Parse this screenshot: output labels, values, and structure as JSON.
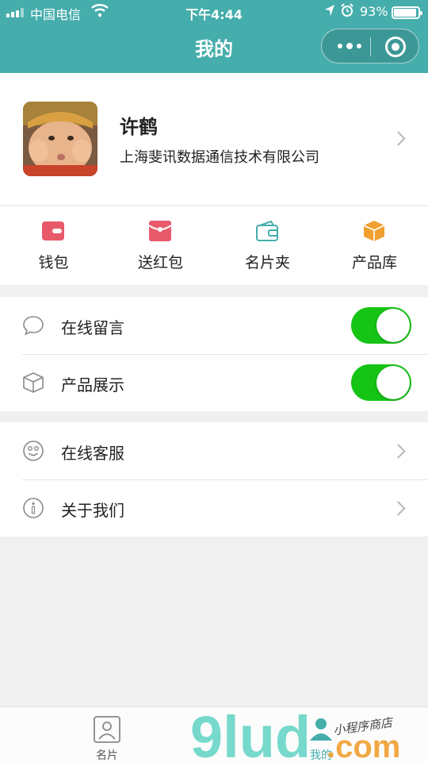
{
  "status_bar": {
    "carrier": "中国电信",
    "time": "下午4:44",
    "battery_percent": "93%",
    "battery_level": 0.93,
    "icons": [
      "signal-icon",
      "wifi-icon",
      "location-icon",
      "alarm-icon",
      "battery-icon"
    ]
  },
  "header": {
    "title": "我的",
    "color": "#45adab"
  },
  "profile": {
    "name": "许鹤",
    "company": "上海斐讯数据通信技术有限公司"
  },
  "shortcuts": [
    {
      "label": "钱包",
      "icon": "wallet-icon",
      "color": "#e85a6a"
    },
    {
      "label": "送红包",
      "icon": "red-envelope-icon",
      "color": "#e85a6a"
    },
    {
      "label": "名片夹",
      "icon": "card-holder-icon",
      "color": "#45adab"
    },
    {
      "label": "产品库",
      "icon": "product-box-icon",
      "color": "#f0a030"
    }
  ],
  "toggles": [
    {
      "label": "在线留言",
      "icon": "chat-bubble-icon",
      "on": true
    },
    {
      "label": "产品展示",
      "icon": "box-icon",
      "on": true
    }
  ],
  "menu": [
    {
      "label": "在线客服",
      "icon": "smiley-icon"
    },
    {
      "label": "关于我们",
      "icon": "info-icon"
    }
  ],
  "tabbar": [
    {
      "label": "名片",
      "icon": "card-person-icon",
      "active": false
    },
    {
      "label": "我的",
      "icon": "person-icon",
      "active": true
    }
  ],
  "watermark": {
    "text": "9lud",
    "suffix": ".com",
    "tagline": "小程序商店"
  },
  "colors": {
    "accent": "#45adab",
    "toggle_on": "#16c415",
    "background": "#f0f0f0"
  }
}
